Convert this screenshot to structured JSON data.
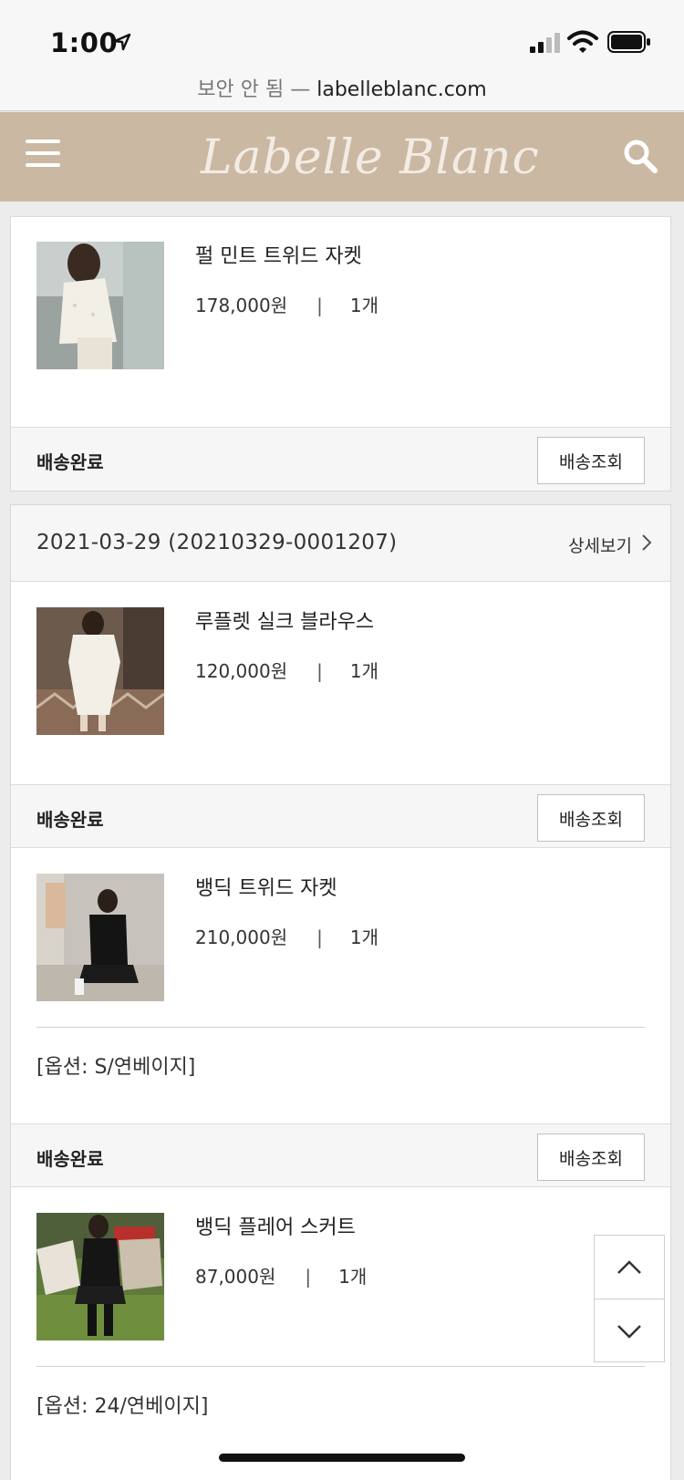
{
  "status": {
    "time": "1:00"
  },
  "browser": {
    "insecure_label": "보안 안 됨 —",
    "domain": "labelleblanc.com"
  },
  "site": {
    "logo": "Labelle Blanc"
  },
  "orders": [
    {
      "items": [
        {
          "name": "펄 민트 트위드 자켓",
          "price": "178,000원",
          "qty": "1개",
          "status": "배송완료",
          "track_label": "배송조회"
        }
      ]
    },
    {
      "date": "2021-03-29 (20210329-0001207)",
      "detail_label": "상세보기",
      "items": [
        {
          "name": "루플렛 실크 블라우스",
          "price": "120,000원",
          "qty": "1개",
          "status": "배송완료",
          "track_label": "배송조회"
        },
        {
          "name": "뱅딕 트위드 자켓",
          "price": "210,000원",
          "qty": "1개",
          "option": "[옵션: S/연베이지]",
          "status": "배송완료",
          "track_label": "배송조회"
        },
        {
          "name": "뱅딕 플레어 스커트",
          "price": "87,000원",
          "qty": "1개",
          "option": "[옵션: 24/연베이지]"
        }
      ]
    }
  ],
  "separator": "|"
}
